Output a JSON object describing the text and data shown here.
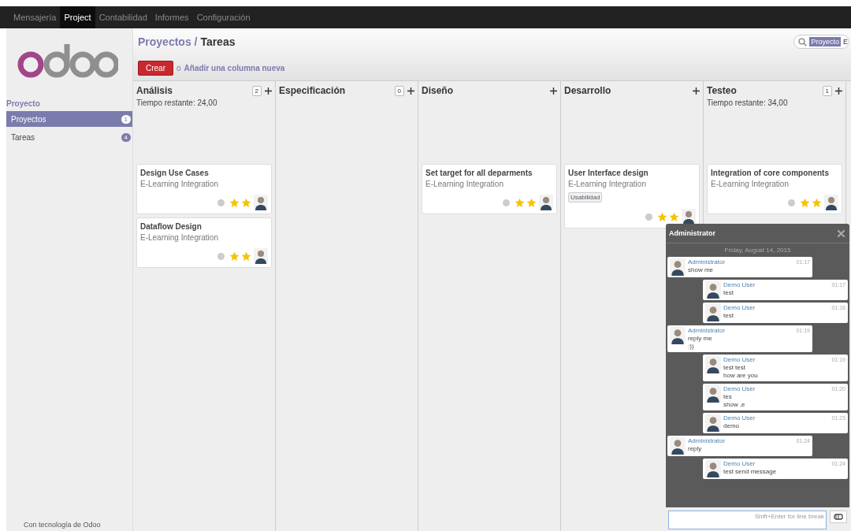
{
  "top_menu": [
    {
      "label": "Mensajería",
      "selected": false
    },
    {
      "label": "Project",
      "selected": true
    },
    {
      "label": "Contabilidad",
      "selected": false
    },
    {
      "label": "Informes",
      "selected": false
    },
    {
      "label": "Configuración",
      "selected": false
    }
  ],
  "sidebar": {
    "section": "Proyecto",
    "items": [
      {
        "label": "Proyectos",
        "count": "1",
        "selected": true
      },
      {
        "label": "Tareas",
        "count": "4",
        "selected": false
      }
    ],
    "footer": "Con tecnología de Odoo"
  },
  "breadcrumb": {
    "parent": "Proyectos",
    "separator": "/",
    "current": "Tareas"
  },
  "search": {
    "facet": "Proyecto",
    "value": "E"
  },
  "actions": {
    "create": "Crear",
    "or": "o",
    "add_column": "Añadir una columna nueva"
  },
  "columns": [
    {
      "name": "Análisis",
      "count": "2",
      "remaining": "Tiempo restante: 24,00",
      "cards": [
        {
          "title": "Design Use Cases",
          "project": "E-Learning Integration",
          "priority_stars": [
            {
              "filled": true
            },
            {
              "filled": true
            }
          ]
        },
        {
          "title": "Dataflow Design",
          "project": "E-Learning Integration",
          "priority_stars": [
            {
              "filled": true
            },
            {
              "filled": true
            }
          ]
        }
      ]
    },
    {
      "name": "Especificación",
      "count": "0"
    },
    {
      "name": "Diseño",
      "cards": [
        {
          "title": "Set target for all deparments",
          "project": "E-Learning Integration",
          "priority_stars": [
            {
              "filled": true
            },
            {
              "filled": true
            }
          ]
        }
      ]
    },
    {
      "name": "Desarrollo",
      "cards": [
        {
          "title": "User Interface design",
          "project": "E-Learning Integration",
          "tag": "Usabilidad",
          "priority_stars": [
            {
              "filled": true
            },
            {
              "filled": true
            }
          ]
        }
      ]
    },
    {
      "name": "Testeo",
      "count": "1",
      "remaining": "Tiempo restante: 34,00",
      "cards": [
        {
          "title": "Integration of core components",
          "project": "E-Learning Integration",
          "priority_stars": [
            {
              "filled": true
            },
            {
              "filled": true
            }
          ]
        }
      ]
    }
  ],
  "chat": {
    "title": "Administrator",
    "date": "Friday, August 14, 2015",
    "placeholder": "Shift+Enter for line break",
    "messages": [
      {
        "kind": "received",
        "author": "Administrator",
        "time": "01:17",
        "lines": [
          "show me"
        ]
      },
      {
        "kind": "sent",
        "author": "Demo User",
        "time": "01:17",
        "lines": [
          "test"
        ]
      },
      {
        "kind": "sent",
        "author": "Demo User",
        "time": "01:18",
        "lines": [
          "test"
        ]
      },
      {
        "kind": "received",
        "author": "Administrator",
        "time": "01:19",
        "lines": [
          "reply me",
          ":))"
        ]
      },
      {
        "kind": "sent",
        "author": "Demo User",
        "time": "01:19",
        "lines": [
          "test test",
          "how are you"
        ]
      },
      {
        "kind": "sent",
        "author": "Demo User",
        "time": "01:20",
        "lines": [
          "tes",
          "show ,e"
        ]
      },
      {
        "kind": "sent",
        "author": "Demo User",
        "time": "01:23",
        "lines": [
          "demo"
        ]
      },
      {
        "kind": "received",
        "author": "Administrator",
        "time": "01:24",
        "lines": [
          "reply"
        ]
      },
      {
        "kind": "sent",
        "author": "Demo User",
        "time": "01:24",
        "lines": [
          "test send message"
        ]
      }
    ]
  }
}
